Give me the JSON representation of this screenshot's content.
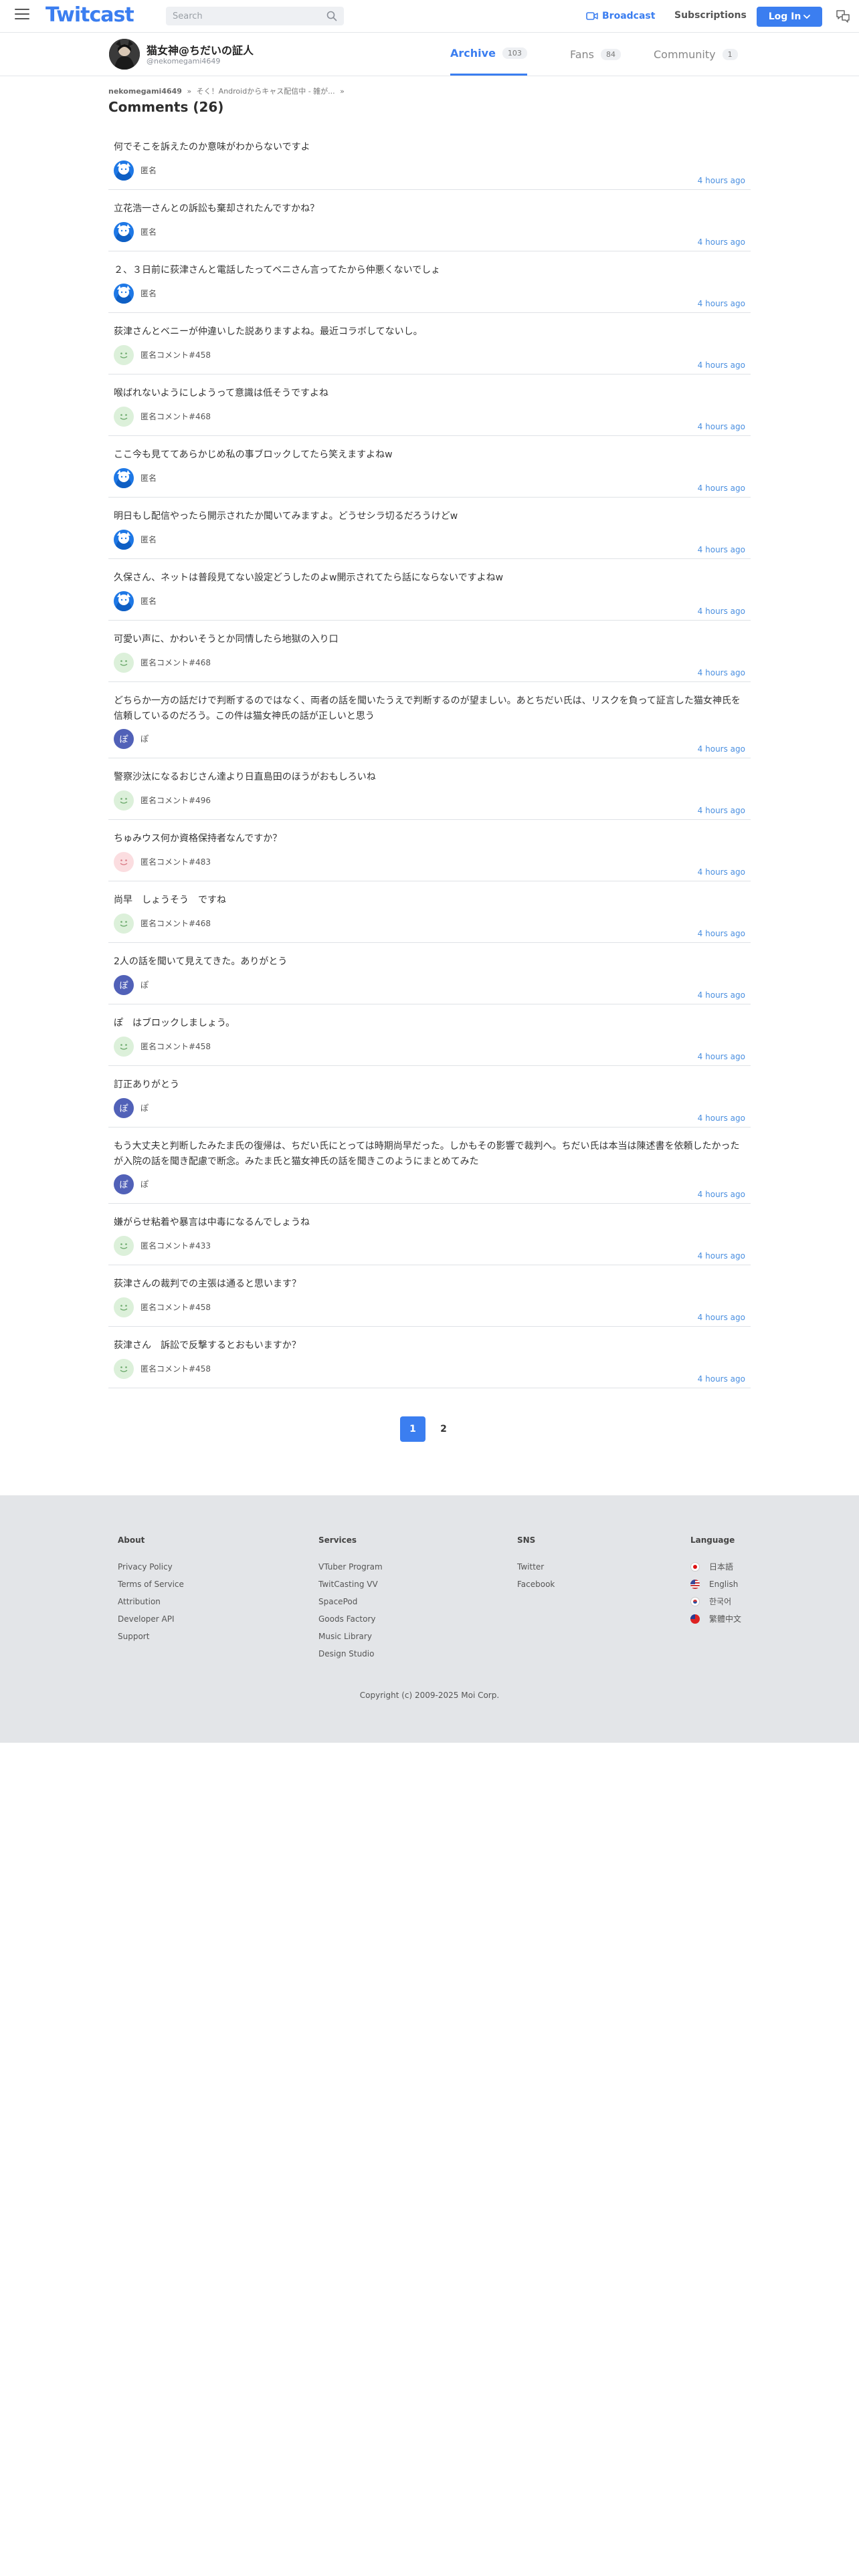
{
  "header": {
    "logo": "Twitcast",
    "search_placeholder": "Search",
    "broadcast": "Broadcast",
    "subscriptions": "Subscriptions",
    "login": "Log In"
  },
  "profile": {
    "name": "猫女神@ちだいの証人",
    "handle": "@nekomegami4649",
    "tabs": [
      {
        "label": "Archive",
        "count": "103"
      },
      {
        "label": "Fans",
        "count": "84"
      },
      {
        "label": "Community",
        "count": "1"
      }
    ]
  },
  "breadcrumb": {
    "user": "nekomegami4649",
    "sep1": "»",
    "title": "そく！Androidからキャス配信中 - 雑が...",
    "sep2": "»"
  },
  "comments_title": "Comments (26)",
  "comments": [
    {
      "text": "何でそこを訴えたのか意味がわからないですよ",
      "name": "匿名",
      "time": "4 hours ago",
      "avatar": "blue"
    },
    {
      "text": "立花浩一さんとの訴訟も棄却されたんですかね？",
      "name": "匿名",
      "time": "4 hours ago",
      "avatar": "blue"
    },
    {
      "text": "２、３日前に荻津さんと電話したってベニさん言ってたから仲悪くないでしょ",
      "name": "匿名",
      "time": "4 hours ago",
      "avatar": "blue"
    },
    {
      "text": "荻津さんとベニーが仲違いした説ありますよね。最近コラボしてないし。",
      "name": "匿名コメント#458",
      "time": "4 hours ago",
      "avatar": "green"
    },
    {
      "text": "喉ばれないようにしようって意識は低そうですよね",
      "name": "匿名コメント#468",
      "time": "4 hours ago",
      "avatar": "green"
    },
    {
      "text": "ここ今も見ててあらかじめ私の事ブロックしてたら笑えますよねw",
      "name": "匿名",
      "time": "4 hours ago",
      "avatar": "blue"
    },
    {
      "text": "明日もし配信やったら開示されたか聞いてみますよ。どうせシラ切るだろうけどw",
      "name": "匿名",
      "time": "4 hours ago",
      "avatar": "blue"
    },
    {
      "text": "久保さん、ネットは普段見てない設定どうしたのよw開示されてたら話にならないですよねw",
      "name": "匿名",
      "time": "4 hours ago",
      "avatar": "blue"
    },
    {
      "text": "可愛い声に、かわいそうとか同情したら地獄の入り口",
      "name": "匿名コメント#468",
      "time": "4 hours ago",
      "avatar": "green"
    },
    {
      "text": "どちらか一方の話だけで判断するのではなく、両者の話を聞いたうえで判断するのが望ましい。あとちだい氏は、リスクを負って証言した猫女神氏を信頼しているのだろう。この件は猫女神氏の話が正しいと思う",
      "name": "ぽ",
      "time": "4 hours ago",
      "avatar": "purple",
      "two": true
    },
    {
      "text": "警察沙汰になるおじさん達より日直島田のほうがおもしろいね",
      "name": "匿名コメント#496",
      "time": "4 hours ago",
      "avatar": "green"
    },
    {
      "text": "ちゅみウス何か資格保持者なんですか？",
      "name": "匿名コメント#483",
      "time": "4 hours ago",
      "avatar": "pink"
    },
    {
      "text": "尚早　しょうそう　ですね",
      "name": "匿名コメント#468",
      "time": "4 hours ago",
      "avatar": "green"
    },
    {
      "text": "2人の話を聞いて見えてきた。ありがとう",
      "name": "ぽ",
      "time": "4 hours ago",
      "avatar": "purple"
    },
    {
      "text": "ぽ　はブロックしましょう。",
      "name": "匿名コメント#458",
      "time": "4 hours ago",
      "avatar": "green"
    },
    {
      "text": "訂正ありがとう",
      "name": "ぽ",
      "time": "4 hours ago",
      "avatar": "purple"
    },
    {
      "text": "もう大丈夫と判断したみたま氏の復帰は、ちだい氏にとっては時期尚早だった。しかもその影響で裁判へ。ちだい氏は本当は陳述書を依頼したかったが入院の話を聞き配慮で断念。みたま氏と猫女神氏の話を聞きこのようにまとめてみた",
      "name": "ぽ",
      "time": "4 hours ago",
      "avatar": "purple",
      "two": true
    },
    {
      "text": "嫌がらせ粘着や暴言は中毒になるんでしょうね",
      "name": "匿名コメント#433",
      "time": "4 hours ago",
      "avatar": "green"
    },
    {
      "text": "荻津さんの裁判での主張は通ると思います？",
      "name": "匿名コメント#458",
      "time": "4 hours ago",
      "avatar": "green"
    },
    {
      "text": "荻津さん　訴訟で反撃するとおもいますか？",
      "name": "匿名コメント#458",
      "time": "4 hours ago",
      "avatar": "green"
    }
  ],
  "pagination": [
    "1",
    "2"
  ],
  "footer": {
    "about": {
      "title": "About",
      "links": [
        "Privacy Policy",
        "Terms of Service",
        "Attribution",
        "Developer API",
        "Support"
      ]
    },
    "services": {
      "title": "Services",
      "links": [
        "VTuber Program",
        "TwitCasting VV",
        "SpacePod",
        "Goods Factory",
        "Music Library",
        "Design Studio"
      ]
    },
    "sns": {
      "title": "SNS",
      "links": [
        "Twitter",
        "Facebook"
      ]
    },
    "language": {
      "title": "Language",
      "links": [
        "日本語",
        "English",
        "한국어",
        "繁體中文"
      ]
    },
    "copyright": "Copyright (c) 2009-2025 Moi Corp."
  },
  "colors": {
    "accent": "#3b7ef0",
    "time": "#4a8fe0",
    "footer_bg": "#e3e5e8"
  }
}
